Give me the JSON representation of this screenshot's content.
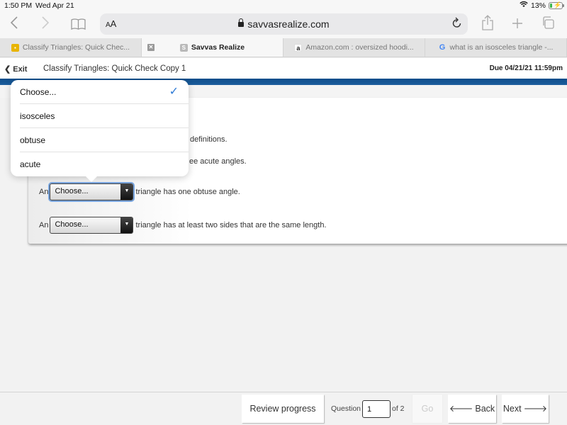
{
  "status_bar": {
    "time": "1:50 PM",
    "date": "Wed Apr 21",
    "battery": "13%"
  },
  "browser": {
    "text_size_label": "AA",
    "url": "savvasrealize.com",
    "tabs": [
      {
        "label": "Classify Triangles: Quick Chec...",
        "favicon": "G",
        "favicon_color": "#e8b400",
        "active": false
      },
      {
        "label": "Savvas Realize",
        "favicon": "S",
        "favicon_color": "#b9b9b9",
        "active": true
      },
      {
        "label": "Amazon.com : oversized hoodi...",
        "favicon": "a",
        "favicon_color": "#222222",
        "active": false
      },
      {
        "label": "what is an isosceles triangle -...",
        "favicon": "G",
        "favicon_color": "#4285f4",
        "active": false
      }
    ]
  },
  "app_header": {
    "exit_label": "Exit",
    "title": "Classify Triangles: Quick Check Copy 1",
    "due": "Due 04/21/21 11:59pm"
  },
  "question": {
    "instruction_fragment": "definitions.",
    "row1_fragment": "ee acute angles.",
    "rows": [
      {
        "prefix": "An",
        "selected": "Choose...",
        "suffix": "triangle has one obtuse angle."
      },
      {
        "prefix": "An",
        "selected": "Choose...",
        "suffix": "triangle has at least two sides that are the same length."
      }
    ]
  },
  "dropdown": {
    "options": [
      "Choose...",
      "isosceles",
      "obtuse",
      "acute"
    ],
    "selected": "Choose..."
  },
  "footer": {
    "review_label": "Review progress",
    "question_label": "Question",
    "question_value": "1",
    "of_label": "of 2",
    "go_label": "Go",
    "back_label": "Back",
    "next_label": "Next"
  },
  "colors": {
    "brand_blue": "#0d4d8a",
    "check_blue": "#2f7bd6"
  }
}
